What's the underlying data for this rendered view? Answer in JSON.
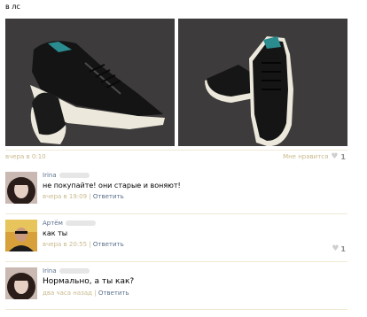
{
  "post": {
    "title": "в лс",
    "date": "вчера в 0:10",
    "like_label": "Мне нравится",
    "like_count": "1"
  },
  "comments": [
    {
      "name": "Irina",
      "text": "не покупайте! они старые и воняют!",
      "time": "вчера в 19:09",
      "reply": "Ответить",
      "likes": ""
    },
    {
      "name": "Артём",
      "text": "как ты",
      "time": "вчера в 20:55",
      "reply": "Ответить",
      "likes": "1"
    },
    {
      "name": "Irina",
      "text": "Нормально, а ты как?",
      "time": "два часа назад",
      "reply": "Ответить",
      "likes": ""
    }
  ],
  "icons": {
    "like": "heart-icon"
  },
  "colors": {
    "date": "#c8b98c",
    "link": "#5a6f8c",
    "divider": "#f0e9d4"
  }
}
